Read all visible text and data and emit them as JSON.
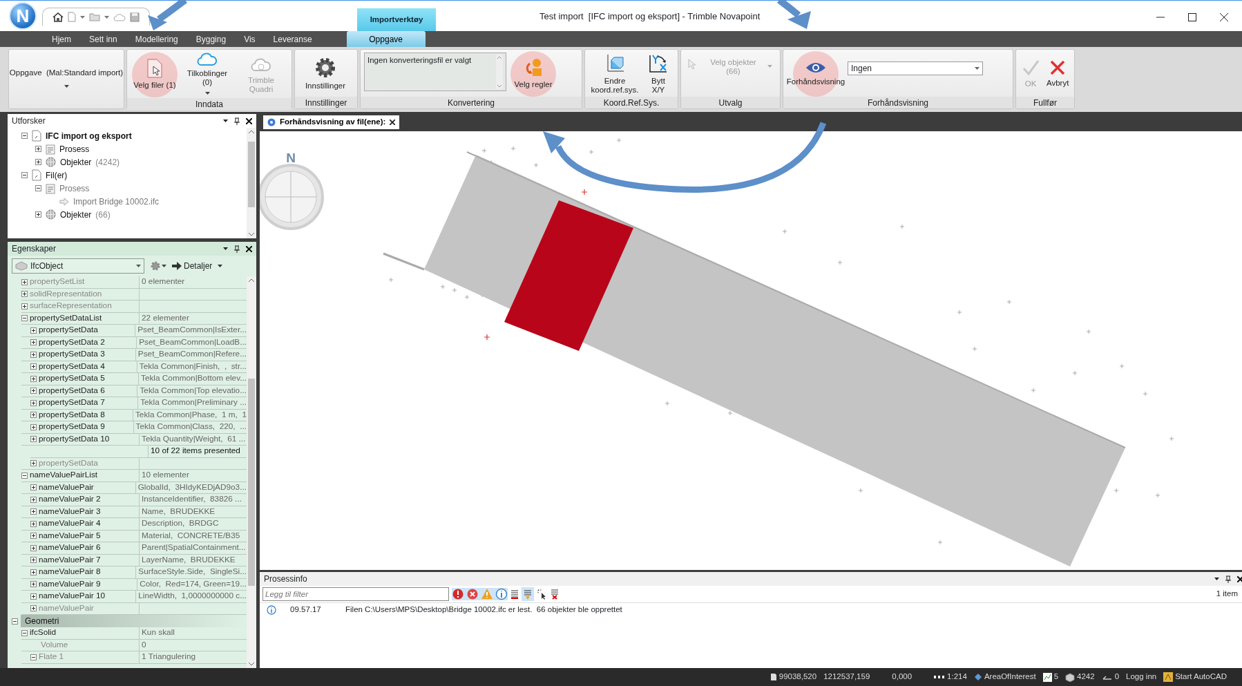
{
  "window": {
    "title": "Test import  [IFC import og eksport] - Trimble Novapoint",
    "context_tab": "Importverktøy",
    "logo_letter": "N"
  },
  "ribbon_tabs": [
    {
      "label": "Hjem",
      "selected": false
    },
    {
      "label": "Sett inn",
      "selected": false
    },
    {
      "label": "Modellering",
      "selected": false
    },
    {
      "label": "Bygging",
      "selected": false
    },
    {
      "label": "Vis",
      "selected": false
    },
    {
      "label": "Leveranse",
      "selected": false
    },
    {
      "label": "Oppgave",
      "selected": true
    }
  ],
  "ribbon_groups": [
    {
      "items": [
        {
          "kind": "menu",
          "label": "Oppgave  (Mal:Standard import)",
          "dropdown": true,
          "disabled": false,
          "highlighted": false
        }
      ]
    },
    {
      "title": "Inndata",
      "items": [
        {
          "kind": "button",
          "label": "Velg filer (1)",
          "dropdown": false,
          "disabled": false,
          "highlighted": true
        },
        {
          "kind": "button",
          "label": "Tilkoblinger (0)",
          "dropdown": true,
          "disabled": false,
          "highlighted": false
        },
        {
          "kind": "button",
          "label": "Trimble Quadri",
          "dropdown": false,
          "disabled": true,
          "highlighted": false
        }
      ]
    },
    {
      "title": "Innstillinger",
      "items": [
        {
          "kind": "button",
          "label": "Innstillinger",
          "dropdown": false,
          "disabled": false,
          "highlighted": false
        }
      ]
    },
    {
      "title": "Konvertering",
      "items": [
        {
          "kind": "listbox",
          "value": "Ingen konverteringsfil er valgt"
        },
        {
          "kind": "button",
          "label": "Velg regler",
          "dropdown": false,
          "disabled": false,
          "highlighted": true
        }
      ]
    },
    {
      "title": "Koord.Ref.Sys.",
      "items": [
        {
          "kind": "button",
          "label": "Endre koord.ref.sys.",
          "dropdown": false,
          "disabled": false,
          "highlighted": false
        },
        {
          "kind": "button",
          "label": "Bytt X/Y",
          "dropdown": false,
          "disabled": false,
          "highlighted": false
        }
      ]
    },
    {
      "title": "Utvalg",
      "items": [
        {
          "kind": "small",
          "label": "Velg objekter (66)",
          "dropdown": true,
          "disabled": true,
          "highlighted": false
        }
      ]
    },
    {
      "title": "Forhåndsvisning",
      "items": [
        {
          "kind": "button",
          "label": "Forhåndsvisning",
          "dropdown": false,
          "disabled": false,
          "highlighted": true
        },
        {
          "kind": "combo",
          "value": "Ingen"
        }
      ]
    },
    {
      "title": "Fullfør",
      "items": [
        {
          "kind": "button",
          "label": "OK",
          "dropdown": false,
          "disabled": true,
          "highlighted": false
        },
        {
          "kind": "button",
          "label": "Avbryt",
          "dropdown": false,
          "disabled": false,
          "highlighted": false
        }
      ]
    }
  ],
  "explorer": {
    "title": "Utforsker",
    "tree": [
      {
        "kind": "file",
        "label": "IFC import og eksport",
        "bold": true,
        "dimmed": false,
        "expanded": true,
        "children": [
          {
            "kind": "process",
            "label": "Prosess",
            "bold": false,
            "dimmed": false,
            "expanded": false
          },
          {
            "kind": "objects",
            "label": "Objekter",
            "count": "(4242)",
            "bold": false,
            "dimmed": false,
            "expanded": false
          }
        ]
      },
      {
        "kind": "file",
        "label": "Fil(er)",
        "bold": false,
        "dimmed": false,
        "expanded": true,
        "children": [
          {
            "kind": "process",
            "label": "Prosess",
            "bold": false,
            "dimmed": true,
            "expanded": true,
            "children": [
              {
                "kind": "step",
                "label": "Import Bridge 10002.ifc",
                "bold": false,
                "dimmed": true
              }
            ]
          },
          {
            "kind": "objects",
            "label": "Objekter",
            "count": "(66)",
            "bold": false,
            "dimmed": false,
            "expanded": false
          }
        ]
      }
    ]
  },
  "properties": {
    "title": "Egenskaper",
    "object": "IfcObject",
    "details_button": "Detaljer",
    "rows": [
      {
        "kind": "row",
        "name": "propertySetList",
        "value": "0 elementer",
        "expanded": false,
        "dimmed": true
      },
      {
        "kind": "row",
        "name": "solidRepresentation",
        "expanded": false,
        "dimmed": true
      },
      {
        "kind": "row",
        "name": "surfaceRepresentation",
        "expanded": false,
        "dimmed": true
      },
      {
        "kind": "row",
        "name": "propertySetDataList",
        "value": "22 elementer",
        "expanded": true,
        "dimmed": false,
        "children": [
          {
            "kind": "row",
            "name": "propertySetData",
            "value": "Pset_BeamCommon|IsExter...",
            "expanded": false,
            "dimmed": false
          },
          {
            "kind": "row",
            "name": "propertySetData 2",
            "value": "Pset_BeamCommon|LoadB...",
            "expanded": false,
            "dimmed": false
          },
          {
            "kind": "row",
            "name": "propertySetData 3",
            "value": "Pset_BeamCommon|Refere...",
            "expanded": false,
            "dimmed": false
          },
          {
            "kind": "row",
            "name": "propertySetData 4",
            "value": "Tekla Common|Finish,  ,  str...",
            "expanded": false,
            "dimmed": false
          },
          {
            "kind": "row",
            "name": "propertySetData 5",
            "value": "Tekla Common|Bottom elev...",
            "expanded": false,
            "dimmed": false
          },
          {
            "kind": "row",
            "name": "propertySetData 6",
            "value": "Tekla Common|Top elevatio...",
            "expanded": false,
            "dimmed": false
          },
          {
            "kind": "row",
            "name": "propertySetData 7",
            "value": "Tekla Common|Preliminary ...",
            "expanded": false,
            "dimmed": false
          },
          {
            "kind": "row",
            "name": "propertySetData 8",
            "value": "Tekla Common|Phase,  1 m,  1",
            "expanded": false,
            "dimmed": false
          },
          {
            "kind": "row",
            "name": "propertySetData 9",
            "value": "Tekla Common|Class,  220,  ...",
            "expanded": false,
            "dimmed": false
          },
          {
            "kind": "row",
            "name": "propertySetData 10",
            "value": "Tekla Quantity|Weight,  61 ...",
            "expanded": false,
            "dimmed": false
          },
          {
            "kind": "note",
            "value": "10 of 22 items presented"
          },
          {
            "kind": "row",
            "name": "propertySetData",
            "expanded": false,
            "dimmed": true
          }
        ]
      },
      {
        "kind": "row",
        "name": "nameValuePairList",
        "value": "10 elementer",
        "expanded": true,
        "dimmed": false,
        "children": [
          {
            "kind": "row",
            "name": "nameValuePair",
            "value": "GlobalId,  3HIdyKEDjAD9o3...",
            "expanded": false,
            "dimmed": false
          },
          {
            "kind": "row",
            "name": "nameValuePair 2",
            "value": "InstanceIdentifier,  83826 ...",
            "expanded": false,
            "dimmed": false
          },
          {
            "kind": "row",
            "name": "nameValuePair 3",
            "value": "Name,  BRUDEKKE",
            "expanded": false,
            "dimmed": false
          },
          {
            "kind": "row",
            "name": "nameValuePair 4",
            "value": "Description,  BRDGC",
            "expanded": false,
            "dimmed": false
          },
          {
            "kind": "row",
            "name": "nameValuePair 5",
            "value": "Material,  CONCRETE/B35",
            "expanded": false,
            "dimmed": false
          },
          {
            "kind": "row",
            "name": "nameValuePair 6",
            "value": "Parent|SpatialContainment...",
            "expanded": false,
            "dimmed": false
          },
          {
            "kind": "row",
            "name": "nameValuePair 7",
            "value": "LayerName,  BRUDEKKE",
            "expanded": false,
            "dimmed": false
          },
          {
            "kind": "row",
            "name": "nameValuePair 8",
            "value": "SurfaceStyle.Side,  SingleSi...",
            "expanded": false,
            "dimmed": false
          },
          {
            "kind": "row",
            "name": "nameValuePair 9",
            "value": "Color,  Red=174, Green=19...",
            "expanded": false,
            "dimmed": false
          },
          {
            "kind": "row",
            "name": "nameValuePair 10",
            "value": "LineWidth,  1,0000000000 c...",
            "expanded": false,
            "dimmed": false
          },
          {
            "kind": "row",
            "name": "nameValuePair",
            "expanded": false,
            "dimmed": true
          }
        ]
      },
      {
        "kind": "category",
        "name": "Geometri",
        "expanded": true,
        "children": [
          {
            "kind": "row",
            "name": "ifcSolid",
            "value": "Kun skall",
            "expanded": true,
            "dimmed": false,
            "children": [
              {
                "kind": "row",
                "name": "Volume",
                "value": "0",
                "dimmed": true
              },
              {
                "kind": "row",
                "name": "Flate 1",
                "value": "1 Triangulering",
                "expanded": true,
                "dimmed": true
              }
            ]
          }
        ]
      }
    ]
  },
  "document_tab": {
    "label": "Forhåndsvisning av fil(ene):",
    "selected": true
  },
  "viewport": {
    "compass_label": "N"
  },
  "process_info": {
    "title": "Prosessinfo",
    "filter": {
      "placeholder": "Legg til filter"
    },
    "item_count": "1 item",
    "log": [
      {
        "time": "09.57.17",
        "message": "Filen C:\\Users\\MPS\\Desktop\\Bridge 10002.ifc er lest.  66 objekter ble opprettet"
      }
    ]
  },
  "status_bar": [
    "99038,520",
    "1212537,159",
    "0,000",
    "1:214",
    "AreaOfInterest",
    "5",
    "4242",
    "0",
    "Logg inn",
    "Start AutoCAD"
  ]
}
